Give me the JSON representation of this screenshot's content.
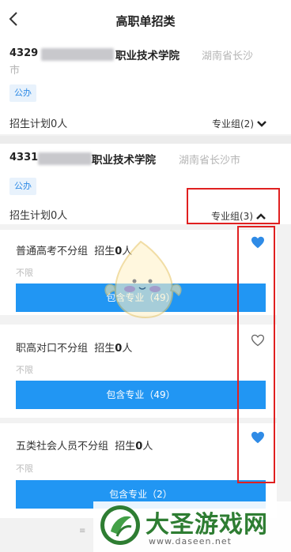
{
  "header": {
    "title": "高职单招类"
  },
  "schools": [
    {
      "code": "4329",
      "name_suffix": "职业技术学院",
      "location_line1": "湖南省长沙",
      "location_line2": "市",
      "tag": "公办",
      "plan": "招生计划0人",
      "group_label": "专业组(2)"
    },
    {
      "code": "4331",
      "name_suffix": "职业技术学院",
      "location": "湖南省长沙市",
      "tag": "公办",
      "plan": "招生计划0人",
      "group_label": "专业组(3)"
    }
  ],
  "subgroups": [
    {
      "name": "普通高考不分组",
      "enroll_prefix": "招生",
      "enroll_num": "0",
      "enroll_suffix": "人",
      "limit": "不限",
      "button": "包含专业（49）",
      "favorited": true
    },
    {
      "name": "职高对口不分组",
      "enroll_prefix": "招生",
      "enroll_num": "0",
      "enroll_suffix": "人",
      "limit": "不限",
      "button": "包含专业（49）",
      "favorited": false
    },
    {
      "name": "五类社会人员不分组",
      "enroll_prefix": "招生",
      "enroll_num": "0",
      "enroll_suffix": "人",
      "limit": "不限",
      "button": "包含专业（2）",
      "favorited": true
    }
  ],
  "watermark": {
    "brand": "大圣游戏网",
    "url": "www.daseen.net"
  },
  "bottom_hint": "≡",
  "colors": {
    "accent": "#2196f3",
    "highlight": "#e02020",
    "tag_bg": "#e8f2fc"
  },
  "icons": {
    "back": "chevron-left-icon",
    "expand": "chevron-down-icon",
    "collapse": "chevron-up-icon",
    "favorite": "heart-icon"
  }
}
